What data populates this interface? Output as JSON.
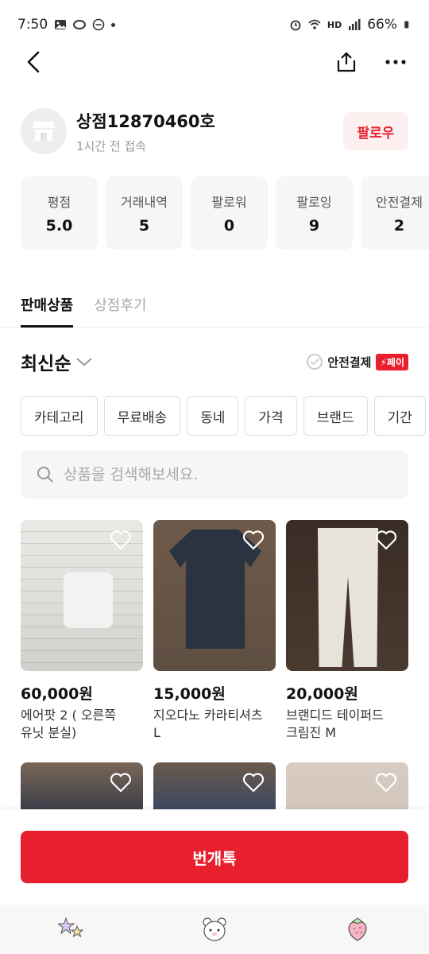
{
  "status_bar": {
    "time": "7:50",
    "battery": "66%",
    "network": "HD"
  },
  "shop": {
    "name": "상점12870460호",
    "last_active": "1시간 전 접속",
    "follow_label": "팔로우"
  },
  "stats": [
    {
      "label": "평점",
      "value": "5.0"
    },
    {
      "label": "거래내역",
      "value": "5"
    },
    {
      "label": "팔로워",
      "value": "0"
    },
    {
      "label": "팔로잉",
      "value": "9"
    },
    {
      "label": "안전결제",
      "value": "2"
    }
  ],
  "tabs": [
    {
      "label": "판매상품",
      "active": true
    },
    {
      "label": "상점후기",
      "active": false
    }
  ],
  "sort": {
    "label": "최신순"
  },
  "safe_pay": {
    "label": "안전결제",
    "badge": "페이"
  },
  "filters": [
    "카테고리",
    "무료배송",
    "동네",
    "가격",
    "브랜드",
    "기간"
  ],
  "search": {
    "placeholder": "상품을 검색해보세요."
  },
  "products": [
    {
      "price": "60,000원",
      "title_line1": "에어팟 2 ( 오른쪽",
      "title_line2": "유닛 분실)"
    },
    {
      "price": "15,000원",
      "title_line1": "지오다노 카라티셔츠",
      "title_line2": "L"
    },
    {
      "price": "20,000원",
      "title_line1": "브랜디드 테이퍼드",
      "title_line2": "크림진 M"
    },
    {
      "price": "",
      "title_line1": "",
      "title_line2": ""
    },
    {
      "price": "",
      "title_line1": "",
      "title_line2": ""
    },
    {
      "price": "",
      "title_line1": "",
      "title_line2": ""
    }
  ],
  "cta": {
    "label": "번개톡"
  },
  "colors": {
    "accent": "#e8202e",
    "follow_bg": "#fdf0f1"
  },
  "icons": [
    "back-arrow-icon",
    "share-icon",
    "more-icon",
    "store-icon",
    "chevron-down-icon",
    "check-circle-icon",
    "lightning-icon",
    "search-icon",
    "heart-icon",
    "home-stars-icon",
    "bear-icon",
    "strawberry-icon"
  ]
}
